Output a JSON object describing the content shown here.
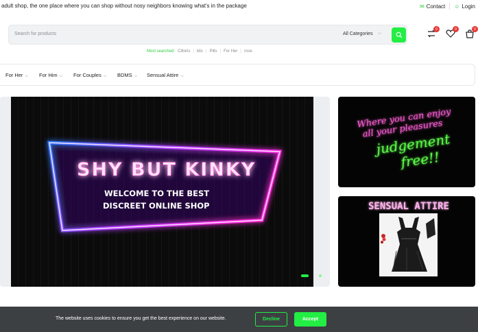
{
  "topbar": {
    "message": "adult shop, the one place where you can shop without nosy neighbors knowing what's in the package",
    "contact": "Contact",
    "login": "Login"
  },
  "search": {
    "placeholder": "Search for products",
    "category": "All Categories"
  },
  "header_badges": {
    "compare": "0",
    "wishlist": "0",
    "cart": "0"
  },
  "most_searched": {
    "label": "Most searched:",
    "terms": [
      "Clitoris",
      "kits",
      "Pills",
      "For Her",
      "rose"
    ]
  },
  "nav": {
    "items": [
      "For Her",
      "For Him",
      "For Couples",
      "BDMS",
      "Sensual Attire"
    ]
  },
  "hero": {
    "headline": "SHY BUT KINKY",
    "line1": "WELCOME TO THE BEST",
    "line2": "DISCREET ONLINE SHOP"
  },
  "promo1": {
    "line1": "Where you can enjoy",
    "line2": "all your pleasures",
    "line3": "judgement",
    "line4": "free!!"
  },
  "promo2": {
    "title": "SENSUAL ATTIRE"
  },
  "cookie": {
    "text": "The website uses cookies to ensure you get the best experience on our website.",
    "decline": "Decline",
    "accept": "Accept"
  },
  "colors": {
    "accent": "#22ee44",
    "badge": "#e53935",
    "cookie_bg": "#3d4043"
  }
}
